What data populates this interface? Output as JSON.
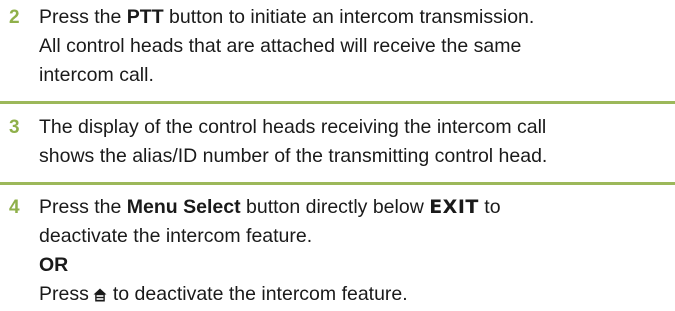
{
  "colors": {
    "accent": "#8fb04a",
    "divider": "#9cb85a",
    "text": "#1a1a1a"
  },
  "steps": [
    {
      "number": "2",
      "lines": [
        {
          "pre": "Press the ",
          "bold": "PTT",
          "post": " button to initiate an intercom transmission."
        },
        {
          "text": "All control heads that are attached will receive the same"
        },
        {
          "text": "intercom call."
        }
      ]
    },
    {
      "number": "3",
      "lines": [
        {
          "text": "The display of the control heads receiving the intercom call"
        },
        {
          "text": "shows the alias/ID number of the transmitting control head."
        }
      ]
    },
    {
      "number": "4",
      "lines": [
        {
          "pre": "Press the ",
          "bold": "Menu Select",
          "mid": " button directly below ",
          "display": "EXIT",
          "post": " to"
        },
        {
          "text": "deactivate the intercom feature."
        },
        {
          "bold": "OR"
        },
        {
          "pre": "Press",
          "icon": "home-icon",
          "post": "to deactivate the intercom feature."
        }
      ]
    }
  ]
}
